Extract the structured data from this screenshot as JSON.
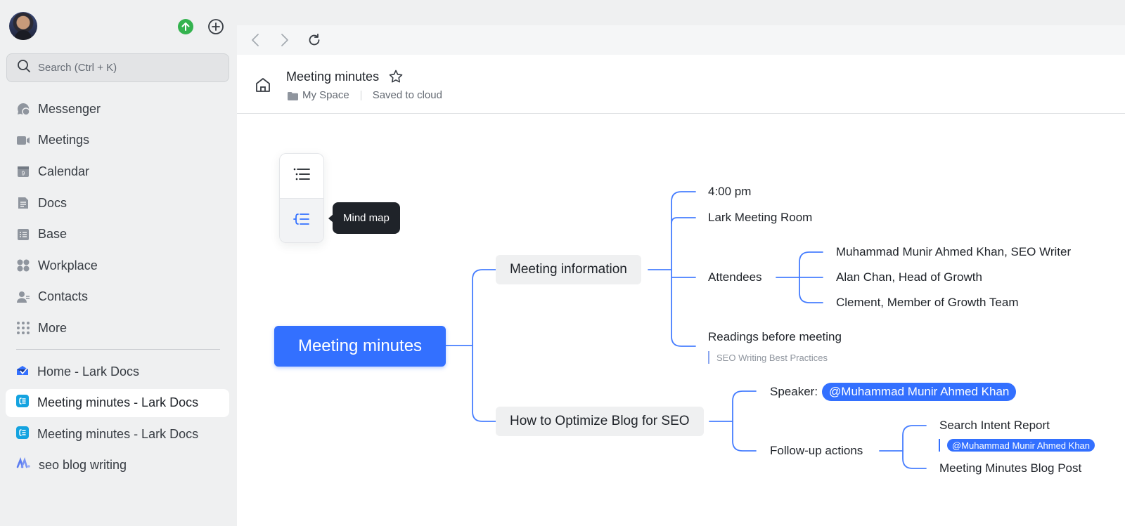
{
  "sidebar": {
    "search_placeholder": "Search (Ctrl + K)",
    "nav": [
      {
        "label": "Messenger",
        "icon": "messenger-icon"
      },
      {
        "label": "Meetings",
        "icon": "video-camera-icon"
      },
      {
        "label": "Calendar",
        "icon": "calendar-icon",
        "day": "9"
      },
      {
        "label": "Docs",
        "icon": "docs-icon"
      },
      {
        "label": "Base",
        "icon": "base-icon"
      },
      {
        "label": "Workplace",
        "icon": "workplace-icon"
      },
      {
        "label": "Contacts",
        "icon": "contacts-icon"
      },
      {
        "label": "More",
        "icon": "more-grid-icon"
      }
    ],
    "recent": [
      {
        "label": "Home - Lark Docs",
        "icon": "lark-docs-home-icon"
      },
      {
        "label": "Meeting minutes - Lark Docs",
        "icon": "mindnote-icon",
        "active": true
      },
      {
        "label": "Meeting minutes - Lark Docs",
        "icon": "mindnote-icon"
      },
      {
        "label": "seo blog writing",
        "icon": "lark-wiki-icon"
      }
    ]
  },
  "document": {
    "title": "Meeting minutes",
    "location": "My Space",
    "save_status": "Saved to cloud"
  },
  "view_switch": {
    "tooltip": "Mind map"
  },
  "mindmap": {
    "root": "Meeting minutes",
    "branch1": {
      "label": "Meeting information",
      "time": "4:00 pm",
      "room": "Lark Meeting Room",
      "attendees_label": "Attendees",
      "attendees": [
        "Muhammad Munir Ahmed Khan, SEO Writer",
        "Alan Chan, Head of Growth",
        "Clement, Member of Growth Team"
      ],
      "readings_label": "Readings before meeting",
      "readings_note": "SEO Writing Best Practices"
    },
    "branch2": {
      "label": "How to Optimize Blog for SEO",
      "speaker_label": "Speaker:",
      "speaker_mention": "@Muhammad Munir Ahmed Khan",
      "followup_label": "Follow-up actions",
      "followups": [
        {
          "label": "Search Intent Report",
          "mention": "@Muhammad Munir Ahmed Khan"
        },
        {
          "label": "Meeting Minutes Blog Post"
        }
      ]
    }
  },
  "colors": {
    "accent": "#3370ff",
    "upgrade_green": "#34b34f",
    "tooltip_bg": "#1f2329"
  }
}
